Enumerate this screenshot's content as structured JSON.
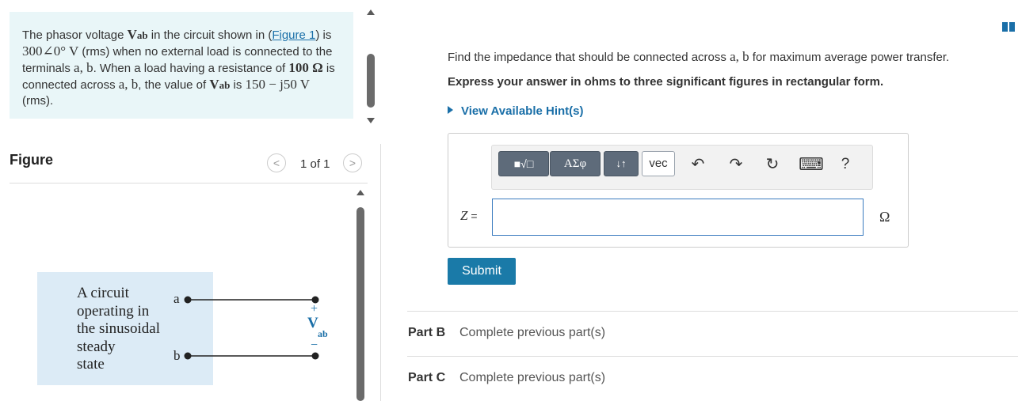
{
  "problem": {
    "t1": "The phasor voltage ",
    "vab": "V",
    "vab_sub": "ab",
    "t2": " in the circuit shown in (",
    "figure_link": "Figure 1",
    "t3": ") is ",
    "value_noload": "300∠0° V",
    "t4": " (rms) when no external load is connected to the terminals ",
    "terminals": "a, b",
    "t5": ". When a load having a resistance of ",
    "resistance": "100 Ω",
    "t6": " is connected across ",
    "terminals2": "a, b",
    "t7": ", the value of ",
    "t8": " is ",
    "value_load": "150 − j50 V",
    "t9": " (rms)."
  },
  "figure": {
    "title": "Figure",
    "counter": "1 of 1",
    "prev": "<",
    "next": ">",
    "circuit_text_lines": [
      "A circuit",
      "operating in",
      "the sinusoidal",
      "steady",
      "state"
    ],
    "terminal_a": "a",
    "terminal_b": "b",
    "plus": "+",
    "minus": "−",
    "vab_label": "V",
    "vab_sub": "ab"
  },
  "question": {
    "q1": "Find the impedance that should be connected across ",
    "terminals": "a, b",
    "q2": " for maximum average power transfer.",
    "instruction": "Express your answer in ohms to three significant figures in rectangular form.",
    "hint": "View Available Hint(s)"
  },
  "toolbar": {
    "templates": "■√□",
    "greek": "ΑΣφ",
    "arrows": "↓↑",
    "vec": "vec",
    "undo": "↶",
    "redo": "↷",
    "reset": "↻",
    "keyboard": "⌨",
    "help": "?"
  },
  "answer": {
    "label": "Z",
    "equals": " =",
    "value": "",
    "unit": "Ω",
    "submit": "Submit"
  },
  "parts": [
    {
      "label": "Part B",
      "status": "Complete previous part(s)"
    },
    {
      "label": "Part C",
      "status": "Complete previous part(s)"
    }
  ],
  "colors": {
    "accent": "#1a7aa8",
    "problem_bg": "#e9f6f8",
    "circuit_bg": "#dcebf6"
  }
}
